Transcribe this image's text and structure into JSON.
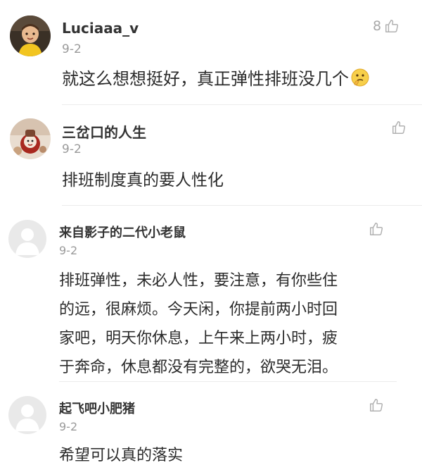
{
  "comments": [
    {
      "username": "Luciaaa_v",
      "date": "9-2",
      "text": "就这么想想挺好，真正弹性排班没几个",
      "emoji": "thinking-face-emoji",
      "likes": "8",
      "avatar": "child-photo-avatar"
    },
    {
      "username": "三岔口的人生",
      "date": "9-2",
      "text": "排班制度真的要人性化",
      "likes": "",
      "avatar": "figurine-photo-avatar"
    },
    {
      "username": "来自影子的二代小老鼠",
      "date": "9-2",
      "text_lines": [
        "排班弹性，未必人性，要注意，有你些住",
        "的远，很麻烦。今天闲，你提前两小时回",
        "家吧，明天你休息，上午来上两小时，疲",
        "于奔命，休息都没有完整的，欲哭无泪。"
      ],
      "likes": "",
      "avatar": "default-gray-avatar"
    },
    {
      "username": "起飞吧小肥猪",
      "date": "9-2",
      "text": "希望可以真的落实",
      "likes": "",
      "avatar": "default-gray-avatar"
    }
  ],
  "colors": {
    "text": "#2b2b2b",
    "muted": "#9a9a9a",
    "divider": "#ececec",
    "placeholder_avatar": "#e9e9e9"
  }
}
